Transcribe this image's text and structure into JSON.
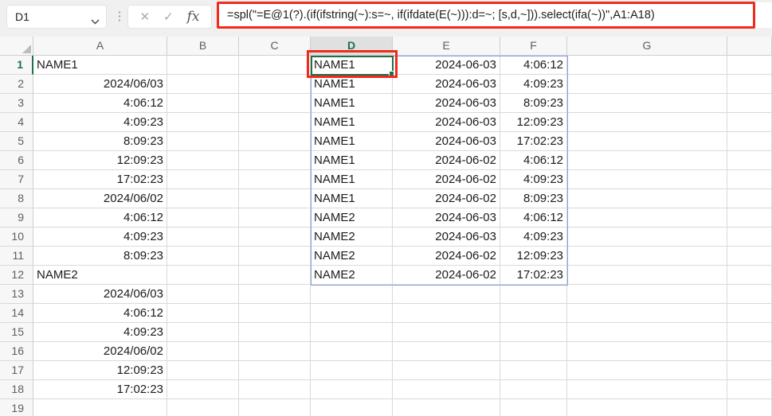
{
  "topbar": {
    "name_box_value": "D1",
    "formula": "=spl(\"=E@1(?).(if(ifstring(~):s=~, if(ifdate(E(~))):d=~; [s,d,~])).select(ifa(~))\",A1:A18)",
    "icons": {
      "more": "⋮",
      "cancel": "✕",
      "confirm": "✓",
      "function": "fx"
    }
  },
  "sheet": {
    "column_headers": [
      "A",
      "B",
      "C",
      "D",
      "E",
      "F",
      "G"
    ],
    "row_count": 19,
    "active_cell": "D1",
    "selected_column": "D",
    "selected_row": 1,
    "column_a": [
      "NAME1",
      "2024/06/03",
      "4:06:12",
      "4:09:23",
      "8:09:23",
      "12:09:23",
      "17:02:23",
      "2024/06/02",
      "4:06:12",
      "4:09:23",
      "8:09:23",
      "NAME2",
      "2024/06/03",
      "4:06:12",
      "4:09:23",
      "2024/06/02",
      "12:09:23",
      "17:02:23"
    ],
    "spill_range": {
      "columns": [
        "D",
        "E",
        "F"
      ],
      "start_row": 1,
      "rows": [
        [
          "NAME1",
          "2024-06-03",
          "4:06:12"
        ],
        [
          "NAME1",
          "2024-06-03",
          "4:09:23"
        ],
        [
          "NAME1",
          "2024-06-03",
          "8:09:23"
        ],
        [
          "NAME1",
          "2024-06-03",
          "12:09:23"
        ],
        [
          "NAME1",
          "2024-06-03",
          "17:02:23"
        ],
        [
          "NAME1",
          "2024-06-02",
          "4:06:12"
        ],
        [
          "NAME1",
          "2024-06-02",
          "4:09:23"
        ],
        [
          "NAME1",
          "2024-06-02",
          "8:09:23"
        ],
        [
          "NAME2",
          "2024-06-03",
          "4:06:12"
        ],
        [
          "NAME2",
          "2024-06-03",
          "4:09:23"
        ],
        [
          "NAME2",
          "2024-06-02",
          "12:09:23"
        ],
        [
          "NAME2",
          "2024-06-02",
          "17:02:23"
        ]
      ]
    }
  },
  "colors": {
    "accent_green": "#1E7145",
    "spill_blue": "#86A3DC",
    "annotation_red": "#F02B1D",
    "header_bg": "#F7F7F7",
    "selected_header_bg": "#E0E0E0",
    "gridline": "#D9D9D9"
  }
}
